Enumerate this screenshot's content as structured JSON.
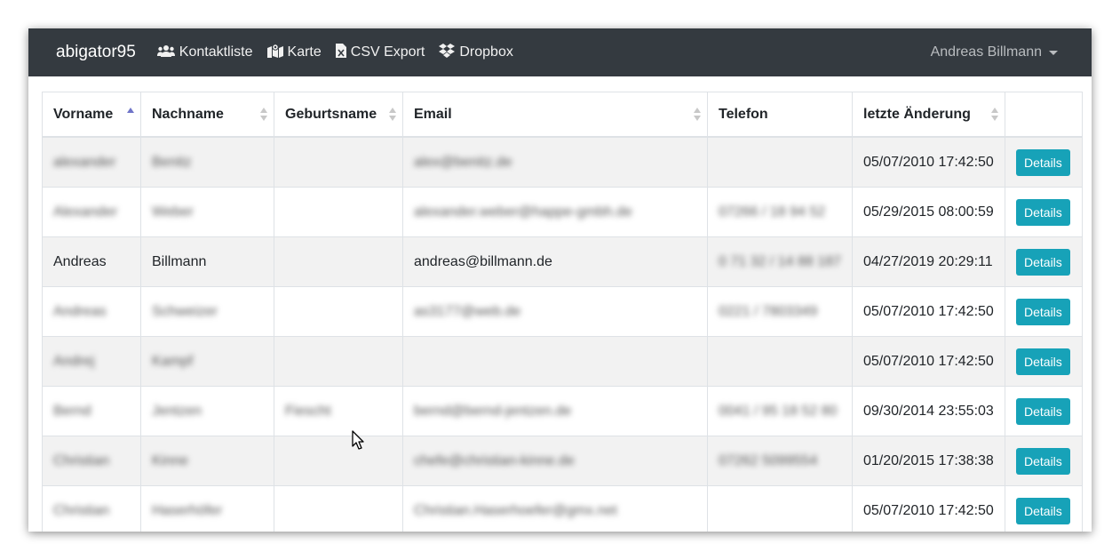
{
  "navbar": {
    "brand": "abigator95",
    "items": [
      {
        "label": "Kontaktliste",
        "icon": "users-icon"
      },
      {
        "label": "Karte",
        "icon": "map-icon"
      },
      {
        "label": "CSV Export",
        "icon": "csv-file-icon"
      },
      {
        "label": "Dropbox",
        "icon": "dropbox-icon"
      }
    ],
    "user": "Andreas Billmann"
  },
  "table": {
    "columns": [
      "Vorname",
      "Nachname",
      "Geburtsname",
      "Email",
      "Telefon",
      "letzte Änderung",
      ""
    ],
    "sorted_column": "Vorname",
    "sort_direction": "ascending",
    "details_label": "Details",
    "rows": [
      {
        "vorname": "alexander",
        "nachname": "Benitz",
        "geburtsname": "",
        "email": "alex@benitz.de",
        "telefon": "",
        "changed": "05/07/2010 17:42:50",
        "blurred": true
      },
      {
        "vorname": "Alexander",
        "nachname": "Weber",
        "geburtsname": "",
        "email": "alexander.weber@happe-gmbh.de",
        "telefon": "07266 / 18 94 52",
        "changed": "05/29/2015 08:00:59",
        "blurred": true
      },
      {
        "vorname": "Andreas",
        "nachname": "Billmann",
        "geburtsname": "",
        "email": "andreas@billmann.de",
        "telefon": "0 71 32 / 14 88 187",
        "changed": "04/27/2019 20:29:11",
        "blurred": false
      },
      {
        "vorname": "Andreas",
        "nachname": "Schweizer",
        "geburtsname": "",
        "email": "as3177@web.de",
        "telefon": "0221 / 7803349",
        "changed": "05/07/2010 17:42:50",
        "blurred": true
      },
      {
        "vorname": "Andrej",
        "nachname": "Kampf",
        "geburtsname": "",
        "email": "",
        "telefon": "",
        "changed": "05/07/2010 17:42:50",
        "blurred": true
      },
      {
        "vorname": "Bernd",
        "nachname": "Jentzen",
        "geburtsname": "Fiescht",
        "email": "bernd@bernd-jentzen.de",
        "telefon": "0041 / 95 18 52 80",
        "changed": "09/30/2014 23:55:03",
        "blurred": true
      },
      {
        "vorname": "Christian",
        "nachname": "Kinne",
        "geburtsname": "",
        "email": "chefe@christian-kinne.de",
        "telefon": "07262 5099554",
        "changed": "01/20/2015 17:38:38",
        "blurred": true
      },
      {
        "vorname": "Christian",
        "nachname": "Haserhöfer",
        "geburtsname": "",
        "email": "Christian.Haserhoefer@gmx.net",
        "telefon": "",
        "changed": "05/07/2010 17:42:50",
        "blurred": true
      }
    ]
  },
  "colors": {
    "navbar_bg": "#343a40",
    "button_bg": "#17a2b8",
    "stripe_bg": "#f2f2f2",
    "sort_active": "#6f74c8"
  }
}
